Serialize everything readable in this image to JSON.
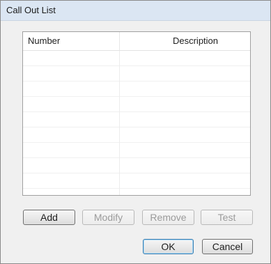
{
  "window": {
    "title": "Call Out List"
  },
  "list": {
    "columns": [
      {
        "label": "Number"
      },
      {
        "label": "Description"
      }
    ],
    "rows": []
  },
  "actions": {
    "add": "Add",
    "modify": "Modify",
    "remove": "Remove",
    "test": "Test"
  },
  "footer": {
    "ok": "OK",
    "cancel": "Cancel"
  },
  "state": {
    "modify_enabled": false,
    "remove_enabled": false,
    "test_enabled": false
  }
}
